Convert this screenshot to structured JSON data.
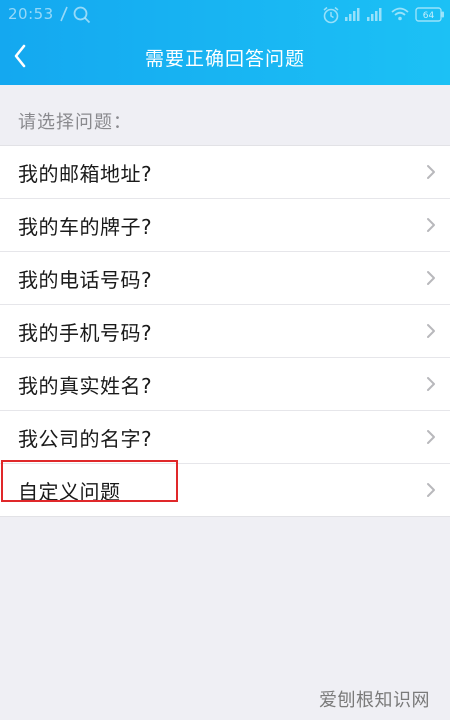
{
  "status_bar": {
    "time": "20:53",
    "battery": "64"
  },
  "navbar": {
    "title": "需要正确回答问题"
  },
  "section_header": "请选择问题：",
  "questions": [
    {
      "label": "我的邮箱地址?"
    },
    {
      "label": "我的车的牌子?"
    },
    {
      "label": "我的电话号码?"
    },
    {
      "label": "我的手机号码?"
    },
    {
      "label": "我的真实姓名?"
    },
    {
      "label": "我公司的名字?"
    },
    {
      "label": "自定义问题"
    }
  ],
  "watermark": "爱刨根知识网",
  "colors": {
    "header_gradient_start": "#14a8f0",
    "header_gradient_end": "#1cc1f5",
    "background": "#efeff4",
    "highlight_border": "#e0282a"
  }
}
